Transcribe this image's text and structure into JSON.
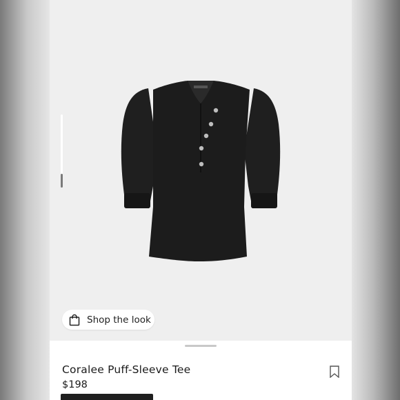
{
  "product_image": {
    "alt": "black puff-sleeve henley top",
    "color": "#1c1c1c"
  },
  "shop_the_look": {
    "label": "Shop the look",
    "icon": "shopping-bag-icon"
  },
  "product": {
    "name": "Coralee Puff-Sleeve Tee",
    "price": "$198"
  },
  "icons": {
    "save": "bookmark-icon"
  },
  "colors": {
    "background": "#efefef",
    "sheet": "#ffffff",
    "text": "#1a1a1a",
    "button": "#1f1f1f"
  }
}
